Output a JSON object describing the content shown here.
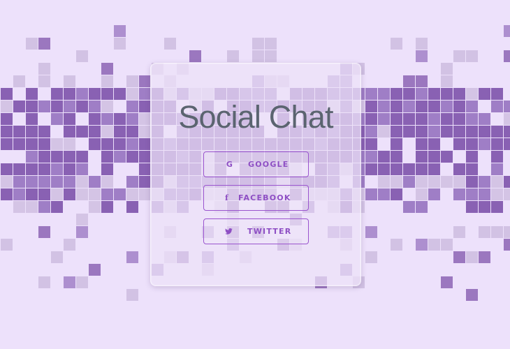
{
  "app": {
    "title": "Social Chat"
  },
  "buttons": {
    "google": "GOOGLE",
    "facebook": "FACEBOOK",
    "twitter": "TWITTER"
  },
  "icons": {
    "google": "G",
    "facebook": "f",
    "twitter": "twitter-bird"
  },
  "colors": {
    "background": "#ede1fb",
    "accent": "#8e4fc4",
    "title": "#5b6470",
    "card": "#ede2f8",
    "pixel_dark": "#7b4ea8",
    "pixel_mid": "#946fbe",
    "pixel_light": "#cbbade"
  }
}
